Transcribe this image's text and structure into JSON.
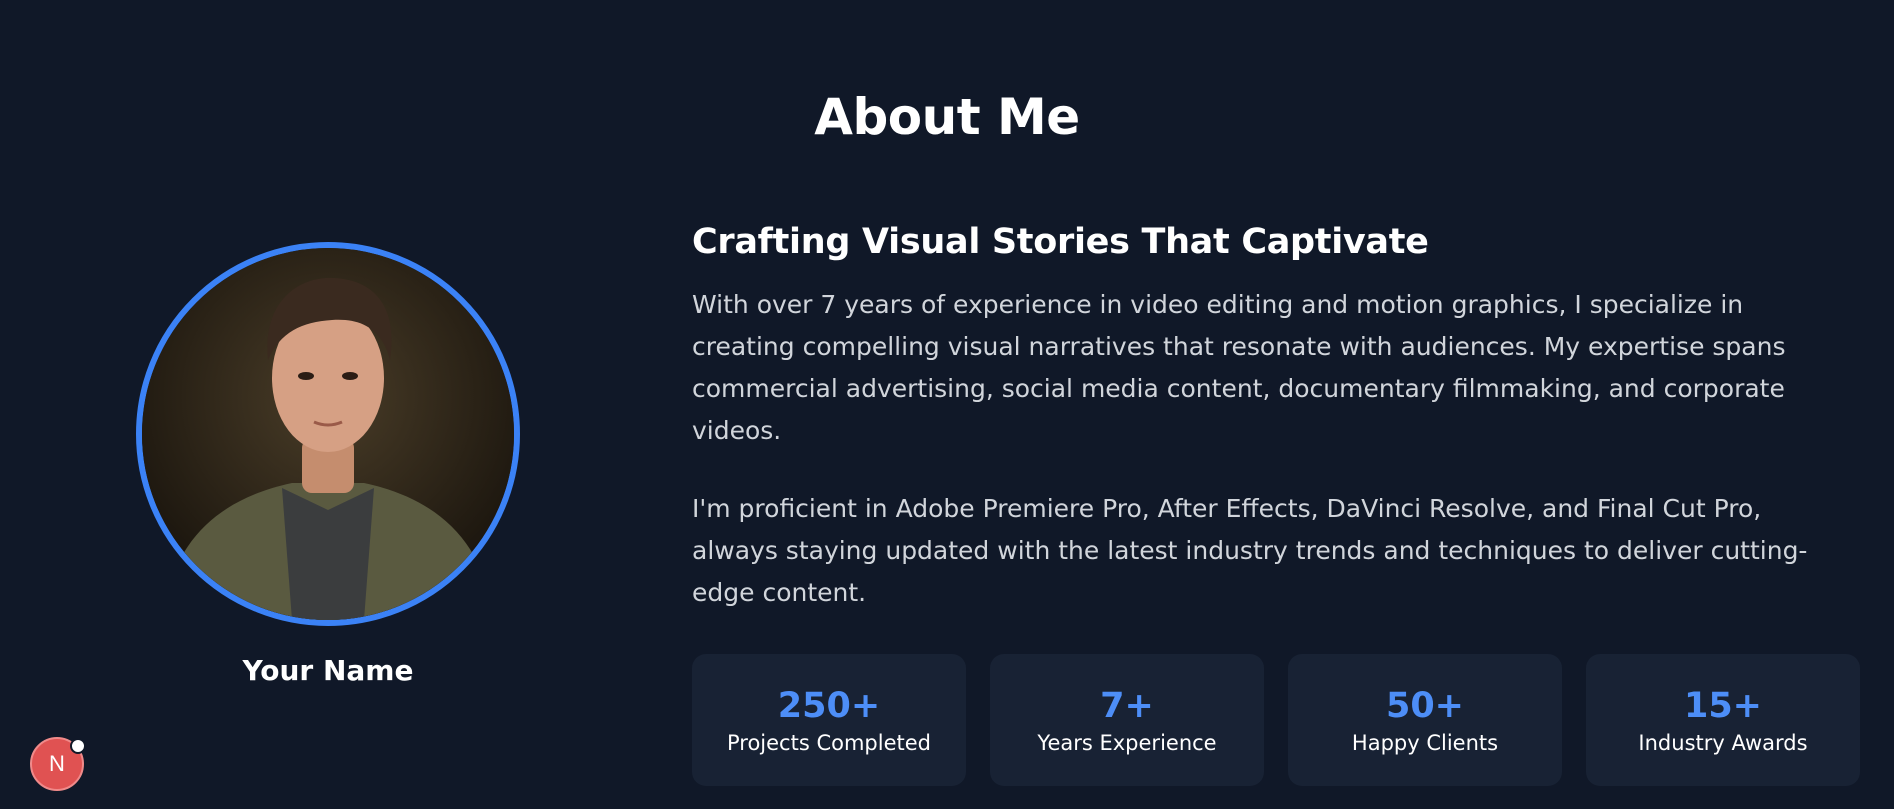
{
  "section": {
    "title": "About Me"
  },
  "profile": {
    "name": "Your Name",
    "photo_icon": "profile-photo"
  },
  "content": {
    "subtitle": "Crafting Visual Stories That Captivate",
    "paragraphs": [
      "With over 7 years of experience in video editing and motion graphics, I specialize in creating compelling visual narratives that resonate with audiences. My expertise spans commercial advertising, social media content, documentary filmmaking, and corporate videos.",
      "I'm proficient in Adobe Premiere Pro, After Effects, DaVinci Resolve, and Final Cut Pro, always staying updated with the latest industry trends and techniques to deliver cutting-edge content."
    ]
  },
  "stats": [
    {
      "value": "250+",
      "label": "Projects Completed"
    },
    {
      "value": "7+",
      "label": "Years Experience"
    },
    {
      "value": "50+",
      "label": "Happy Clients"
    },
    {
      "value": "15+",
      "label": "Industry Awards"
    }
  ],
  "dev_badge": {
    "letter": "N"
  },
  "colors": {
    "background": "#101828",
    "accent": "#3b82f6",
    "card": "#182234",
    "stat_value": "#4d8ef7"
  }
}
